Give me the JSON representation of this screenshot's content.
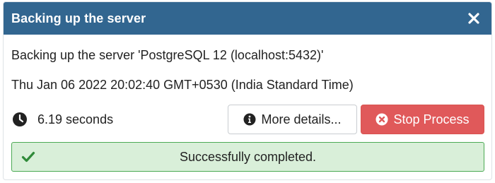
{
  "dialog": {
    "title": "Backing up the server",
    "close_icon": "close-icon",
    "message": "Backing up the server 'PostgreSQL 12 (localhost:5432)'",
    "timestamp": "Thu Jan 06 2022 20:02:40 GMT+0530 (India Standard Time)",
    "duration": "6.19 seconds",
    "duration_icon": "clock-icon",
    "more_details_label": "More details...",
    "more_details_icon": "info-circle-icon",
    "stop_label": "Stop Process",
    "stop_icon": "times-circle-icon",
    "status_text": "Successfully completed.",
    "status_icon": "check-icon"
  },
  "colors": {
    "header_bg": "#326690",
    "stop_button_bg": "#e0595a",
    "success_bg": "#d9efd9",
    "success_border": "#4caa54",
    "success_icon": "#2f8a39"
  }
}
